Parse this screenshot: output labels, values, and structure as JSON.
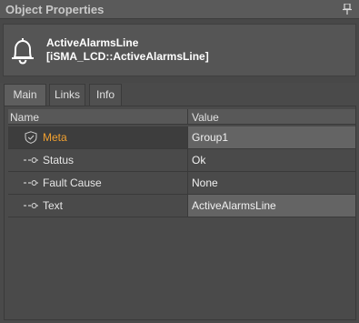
{
  "panel": {
    "title": "Object Properties"
  },
  "object": {
    "name": "ActiveAlarmsLine",
    "type": "[iSMA_LCD::ActiveAlarmsLine]",
    "icon": "bell-icon"
  },
  "tabs": [
    {
      "label": "Main",
      "active": true
    },
    {
      "label": "Links",
      "active": false
    },
    {
      "label": "Info",
      "active": false
    }
  ],
  "grid": {
    "columns": [
      "Name",
      "Value"
    ],
    "rows": [
      {
        "name": "Meta",
        "value": "Group1",
        "icon": "shield-icon",
        "highlight": true
      },
      {
        "name": "Status",
        "value": "Ok",
        "icon": "slot-connector-icon"
      },
      {
        "name": "Fault Cause",
        "value": "None",
        "icon": "slot-connector-icon"
      },
      {
        "name": "Text",
        "value": "ActiveAlarmsLine",
        "icon": "slot-connector-icon"
      }
    ]
  },
  "colors": {
    "meta_label": "#f0a030"
  }
}
